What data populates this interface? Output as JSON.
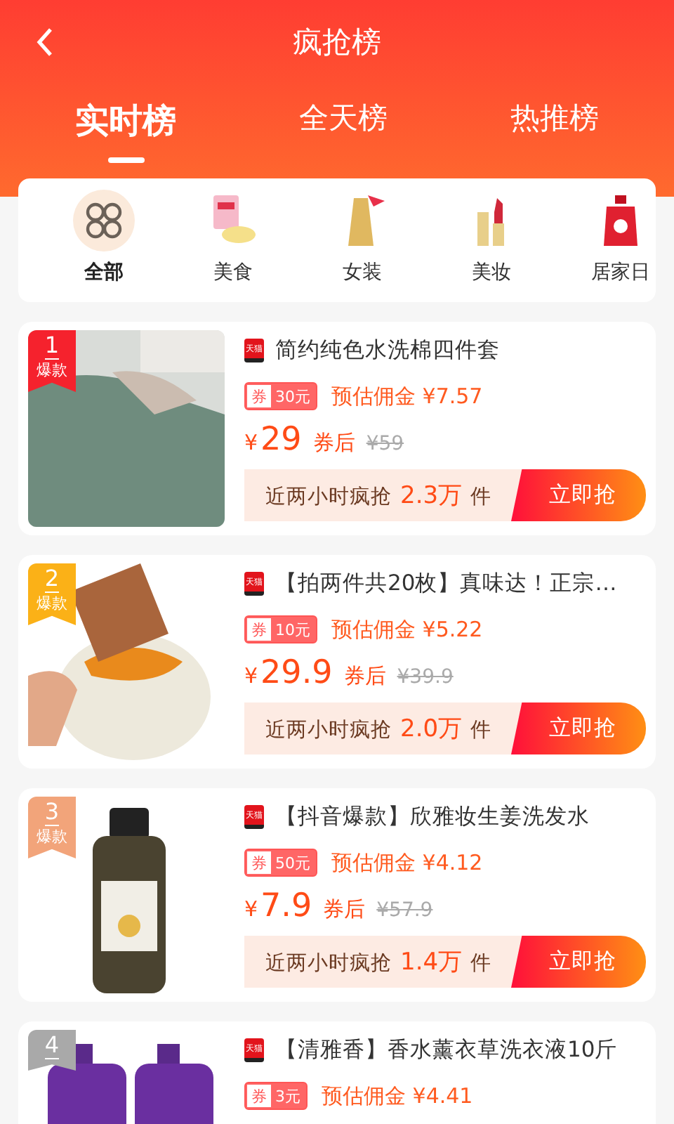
{
  "header": {
    "title": "疯抢榜"
  },
  "tabs": [
    {
      "label": "实时榜",
      "selected": true
    },
    {
      "label": "全天榜",
      "selected": false
    },
    {
      "label": "热推榜",
      "selected": false
    }
  ],
  "categories": [
    {
      "label": "全部",
      "kind": "all",
      "selected": true
    },
    {
      "label": "美食",
      "kind": "snack",
      "selected": false
    },
    {
      "label": "女装",
      "kind": "dress",
      "selected": false
    },
    {
      "label": "美妆",
      "kind": "lipstick",
      "selected": false
    },
    {
      "label": "居家日",
      "kind": "detergent",
      "selected": false
    }
  ],
  "products": [
    {
      "rank": "1",
      "rank_tag": "爆款",
      "color": "#f5222d",
      "kind": "bedding",
      "store": "天猫",
      "title": "简约纯色水洗棉四件套",
      "coupon_label": "券",
      "coupon": "30元",
      "commission_label": "预估佣金",
      "commission": "¥7.57",
      "currency": "¥",
      "price": "29",
      "after_coupon": "券后",
      "original_price": "¥59",
      "sales_label": "近两小时疯抢",
      "sales": "2.3万",
      "sales_unit": "件",
      "button": "立即抢"
    },
    {
      "rank": "2",
      "rank_tag": "爆款",
      "color": "#fbb117",
      "kind": "egg",
      "store": "天猫",
      "title": "【拍两件共20枚】真味达！正宗…",
      "coupon_label": "券",
      "coupon": "10元",
      "commission_label": "预估佣金",
      "commission": "¥5.22",
      "currency": "¥",
      "price": "29.9",
      "after_coupon": "券后",
      "original_price": "¥39.9",
      "sales_label": "近两小时疯抢",
      "sales": "2.0万",
      "sales_unit": "件",
      "button": "立即抢"
    },
    {
      "rank": "3",
      "rank_tag": "爆款",
      "color": "#f2a47a",
      "kind": "bottle",
      "store": "天猫",
      "title": "【抖音爆款】欣雅妆生姜洗发水",
      "coupon_label": "券",
      "coupon": "50元",
      "commission_label": "预估佣金",
      "commission": "¥4.12",
      "currency": "¥",
      "price": "7.9",
      "after_coupon": "券后",
      "original_price": "¥57.9",
      "sales_label": "近两小时疯抢",
      "sales": "1.4万",
      "sales_unit": "件",
      "button": "立即抢"
    },
    {
      "rank": "4",
      "color": "#a9a9a9",
      "kind": "detergent",
      "store": "天猫",
      "title": "【清雅香】香水薰衣草洗衣液10斤",
      "coupon_label": "券",
      "coupon": "3元",
      "commission_label": "预估佣金",
      "commission": "¥4.41"
    }
  ]
}
